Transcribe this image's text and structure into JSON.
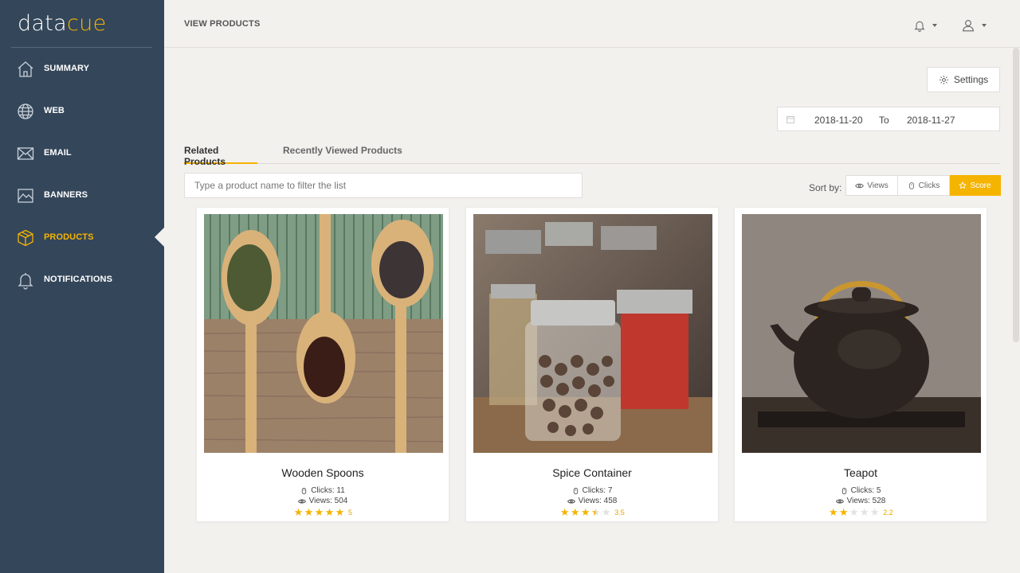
{
  "brand": {
    "part1": "data",
    "part2": "cue"
  },
  "sidebar": {
    "items": [
      {
        "label": "SUMMARY",
        "icon": "home-icon",
        "active": false
      },
      {
        "label": "WEB",
        "icon": "globe-icon",
        "active": false
      },
      {
        "label": "EMAIL",
        "icon": "envelope-icon",
        "active": false
      },
      {
        "label": "BANNERS",
        "icon": "image-icon",
        "active": false
      },
      {
        "label": "PRODUCTS",
        "icon": "box-icon",
        "active": true
      },
      {
        "label": "NOTIFICATIONS",
        "icon": "bell-icon",
        "active": false
      }
    ]
  },
  "header": {
    "title": "VIEW PRODUCTS",
    "icons": [
      "bell-icon",
      "user-icon"
    ]
  },
  "toolbar": {
    "settings_label": "Settings"
  },
  "date_range": {
    "from": "2018-11-20",
    "separator": "To",
    "to": "2018-11-27"
  },
  "tabs": [
    {
      "label": "Related Products",
      "active": true
    },
    {
      "label": "Recently Viewed Products",
      "active": false
    }
  ],
  "search": {
    "placeholder": "Type a product name to filter the list",
    "value": ""
  },
  "sort": {
    "label": "Sort by:",
    "options": [
      {
        "label": "Views",
        "icon": "eye-icon",
        "active": false
      },
      {
        "label": "Clicks",
        "icon": "mouse-icon",
        "active": false
      },
      {
        "label": "Score",
        "icon": "star-icon",
        "active": true
      }
    ]
  },
  "products": [
    {
      "name": "Wooden Spoons",
      "clicks": "Clicks: 11",
      "views": "Views: 504",
      "rating": 5,
      "rating_label": "5"
    },
    {
      "name": "Spice Container",
      "clicks": "Clicks: 7",
      "views": "Views: 458",
      "rating": 3.5,
      "rating_label": "3.5"
    },
    {
      "name": "Teapot",
      "clicks": "Clicks: 5",
      "views": "Views: 528",
      "rating": 2,
      "rating_label": "2.2"
    }
  ],
  "colors": {
    "sidebar": "#34465a",
    "accent": "#f5b400",
    "background": "#f3f1ee"
  }
}
